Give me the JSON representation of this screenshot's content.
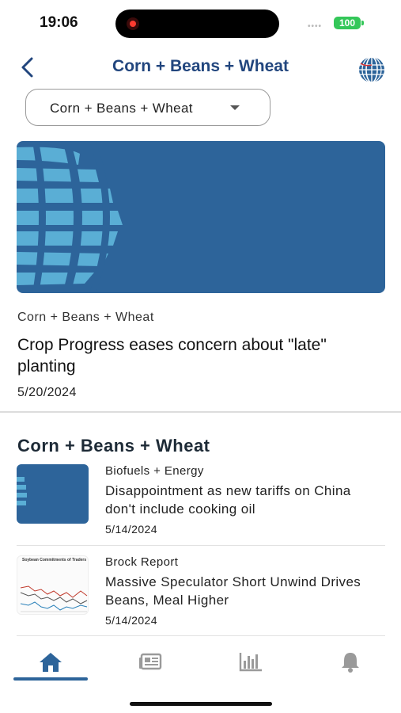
{
  "status_bar": {
    "time": "19:06",
    "battery": "100"
  },
  "header": {
    "title": "Corn + Beans + Wheat"
  },
  "filter": {
    "selected": "Corn + Beans + Wheat"
  },
  "featured": {
    "category": "Corn + Beans + Wheat",
    "title": "Crop Progress eases concern about \"late\" planting",
    "date": "5/20/2024"
  },
  "section": {
    "title": "Corn + Beans + Wheat",
    "items": [
      {
        "category": "Biofuels + Energy",
        "title": "Disappointment as new tariffs on China don't include cooking oil",
        "date": "5/14/2024"
      },
      {
        "category": "Brock Report",
        "title": "Massive Speculator Short Unwind Drives Beans, Meal Higher",
        "date": "5/14/2024",
        "thumb_caption": "Soybean Commitments of Traders"
      }
    ]
  },
  "tabbar": {
    "tabs": [
      "home",
      "news",
      "charts",
      "alerts"
    ],
    "active": "home"
  },
  "colors": {
    "brand_blue": "#2d649a",
    "title_navy": "#22467e",
    "globe_light": "#5aaed5"
  }
}
